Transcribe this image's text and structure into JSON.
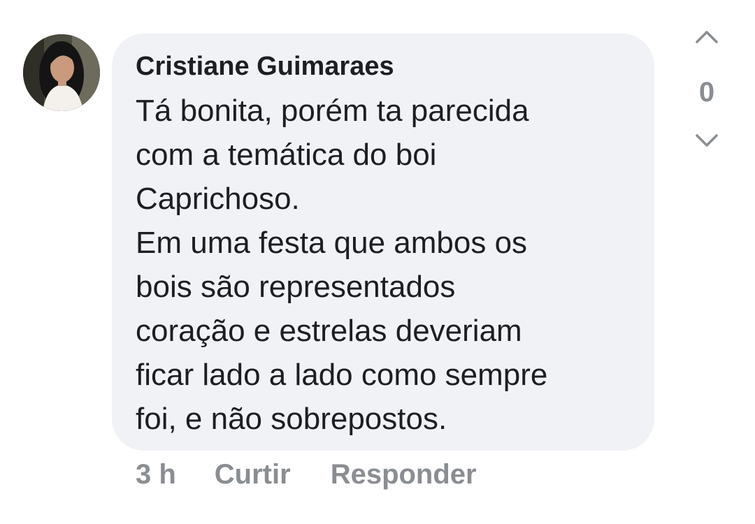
{
  "comment": {
    "author": "Cristiane Guimaraes",
    "body_lines": [
      "Tá bonita, porém ta parecida",
      "com a temática do boi",
      "Caprichoso.",
      "Em uma festa que ambos os",
      "bois são representados",
      "coração e estrelas deveriam",
      "ficar lado a lado como sempre",
      "foi, e não sobrepostos."
    ],
    "timestamp": "3 h",
    "like_label": "Curtir",
    "reply_label": "Responder"
  },
  "votes": {
    "count": "0",
    "up_icon": "chevron-up-icon",
    "down_icon": "chevron-down-icon"
  },
  "colors": {
    "bubble_bg": "#f0f2f5",
    "text": "#1c1e21",
    "muted": "#8a8d91"
  }
}
